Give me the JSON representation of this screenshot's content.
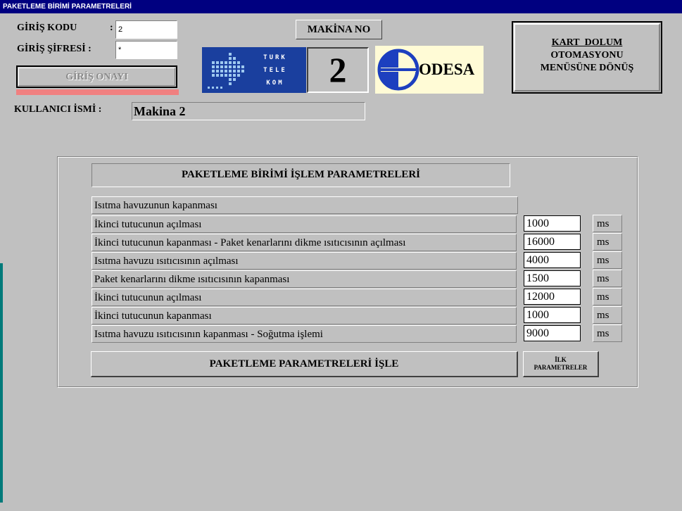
{
  "window": {
    "title": "PAKETLEME BİRİMİ PARAMETRELERİ"
  },
  "login": {
    "code_label": "GİRİŞ KODU",
    "code_colon": ":",
    "code_value": "2",
    "password_label": "GİRİŞ ŞİFRESİ :",
    "password_value": "*",
    "confirm_button": "GİRİŞ ONAYI"
  },
  "machine": {
    "label": "MAKİNA NO",
    "number": "2"
  },
  "logos": {
    "turk_telekom": [
      "TURK",
      "TELE",
      "KOM"
    ],
    "odesa": "ODESA"
  },
  "menu_button": {
    "line1": "KART_DOLUM",
    "line2": "OTOMASYONU",
    "line3": "MENÜSÜNE DÖNÜŞ"
  },
  "user": {
    "label": "KULLANICI İSMİ :",
    "value": "Makina 2"
  },
  "params": {
    "heading": "PAKETLEME BİRİMİ İŞLEM PARAMETRELERİ",
    "header_row": "Isıtma havuzunun kapanması",
    "rows": [
      {
        "label": "İkinci tutucunun açılması",
        "value": "1000",
        "unit": "ms"
      },
      {
        "label": "İkinci tutucunun kapanması - Paket kenarlarını dikme ısıtıcısının açılması",
        "value": "16000",
        "unit": "ms"
      },
      {
        "label": "Isıtma havuzu ısıtıcısının açılması",
        "value": "4000",
        "unit": "ms"
      },
      {
        "label": "Paket kenarlarını dikme ısıtıcısının kapanması",
        "value": "1500",
        "unit": "ms"
      },
      {
        "label": "İkinci tutucunun açılması",
        "value": "12000",
        "unit": "ms"
      },
      {
        "label": "İkinci tutucunun kapanması",
        "value": "1000",
        "unit": "ms"
      },
      {
        "label": "Isıtma havuzu ısıtıcısının kapanması - Soğutma işlemi",
        "value": "9000",
        "unit": "ms"
      }
    ],
    "process_button": "PAKETLEME PARAMETRELERİ İŞLE",
    "initial_button_line1": "İLK",
    "initial_button_line2": "PARAMETRELER"
  },
  "colors": {
    "title_bar": "#000080",
    "background": "#c0c0c0",
    "confirm_underline": "#f08080",
    "telekom_blue": "#1a3f9e",
    "odesa_blue": "#1d3fbf"
  }
}
